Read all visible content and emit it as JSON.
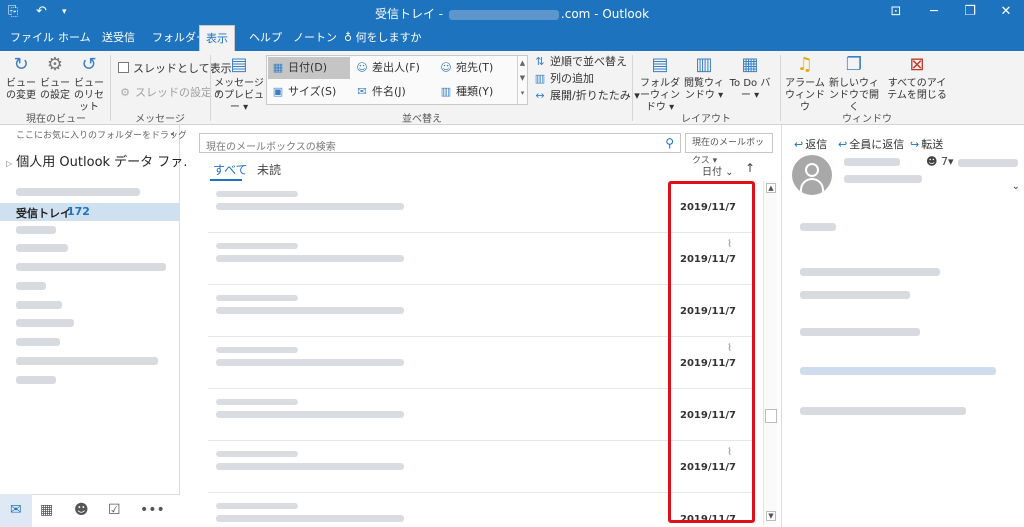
{
  "titlebar": {
    "title_prefix": "受信トレイ - ",
    "title_suffix": ".com - Outlook",
    "icons": [
      "outlook-app-icon",
      "undo-icon",
      "customize-qa-icon",
      "ribbon-display-icon",
      "minimize-icon",
      "restore-icon",
      "close-icon"
    ]
  },
  "tabs": [
    {
      "label": "ファイル"
    },
    {
      "label": "ホーム"
    },
    {
      "label": "送受信"
    },
    {
      "label": "フォルダー"
    },
    {
      "label": "表示"
    },
    {
      "label": "ヘルプ"
    },
    {
      "label": "ノートン"
    },
    {
      "label": "何をしますか"
    }
  ],
  "ribbon": {
    "current_view": {
      "change_view": "ビューの変更",
      "view_settings": "ビューの設定",
      "reset_view": "ビューのリセット",
      "group": "現在のビュー"
    },
    "messages": {
      "show_as_threads": "スレッドとして表示",
      "thread_settings": "スレッドの設定",
      "group": "メッセージ"
    },
    "arrangement": {
      "message_preview": "メッセージのプレビュー",
      "date": "日付(D)",
      "from": "差出人(F)",
      "to": "宛先(T)",
      "size": "サイズ(S)",
      "subject": "件名(J)",
      "type": "種類(Y)",
      "reverse_sort": "逆順で並べ替え",
      "add_columns": "列の追加",
      "expand_collapse": "展開/折りたたみ",
      "group": "並べ替え"
    },
    "layout": {
      "folder_pane": "フォルダーウィンドウ",
      "reading_pane": "閲覧ウィンドウ",
      "todo_bar": "To Do バー",
      "group": "レイアウト"
    },
    "window": {
      "reminders": "アラームウィンドウ",
      "open_new_window": "新しいウィンドウで開く",
      "close_all_items": "すべてのアイテムを閉じる",
      "group": "ウィンドウ"
    }
  },
  "navpane": {
    "favorites_hint": "ここにお気に入りのフォルダーをドラッグし",
    "account": "個人用 Outlook データ ファ…",
    "inbox_label": "受信トレイ",
    "inbox_count": "172"
  },
  "msglist": {
    "search_placeholder": "現在のメールボックスの検索",
    "scope": "現在のメールボックス",
    "filter_all": "すべて",
    "filter_unread": "未読",
    "sort_by": "日付",
    "messages": [
      {
        "date": "2019/11/7",
        "attachment": false
      },
      {
        "date": "2019/11/7",
        "attachment": true
      },
      {
        "date": "2019/11/7",
        "attachment": false
      },
      {
        "date": "2019/11/7",
        "attachment": true
      },
      {
        "date": "2019/11/7",
        "attachment": false
      },
      {
        "date": "2019/11/7",
        "attachment": true
      },
      {
        "date": "2019/11/7",
        "attachment": false
      }
    ]
  },
  "readpane": {
    "reply": "返信",
    "reply_all": "全員に返信",
    "forward": "転送",
    "people_count": "7"
  },
  "colors": {
    "accent": "#1e73be",
    "highlight_border": "#e0101a"
  }
}
